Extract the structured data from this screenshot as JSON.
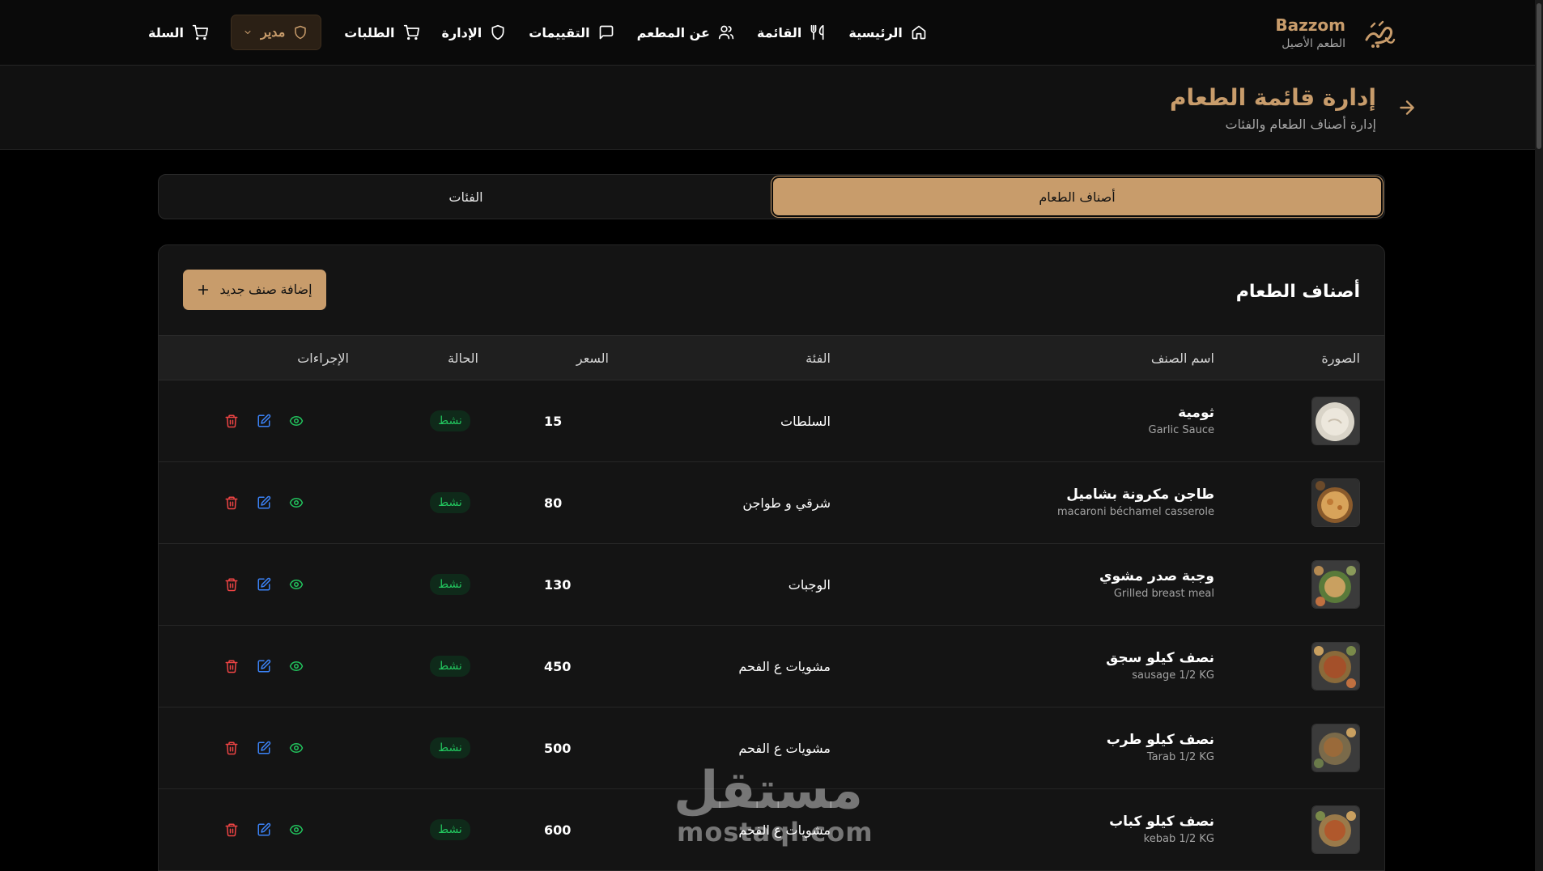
{
  "brand": {
    "name": "Bazzom",
    "tagline": "الطعم الأصيل",
    "logo_icon": "calligraphy-logo"
  },
  "nav": {
    "home": "الرئيسية",
    "menu": "القائمة",
    "about": "عن المطعم",
    "reviews": "التقييمات",
    "admin": "الإدارة",
    "orders": "الطلبات",
    "role": "مدير",
    "cart": "السلة"
  },
  "header": {
    "title": "إدارة قائمة الطعام",
    "subtitle": "إدارة أصناف الطعام والفئات"
  },
  "tabs": [
    {
      "label": "أصناف الطعام",
      "active": true
    },
    {
      "label": "الفئات",
      "active": false
    }
  ],
  "card": {
    "title": "أصناف الطعام",
    "add_button": "إضافة صنف جديد"
  },
  "table": {
    "columns": {
      "image": "الصورة",
      "name": "اسم الصنف",
      "category": "الفئة",
      "price": "السعر",
      "status": "الحالة",
      "actions": "الإجراءات"
    },
    "rows": [
      {
        "name_ar": "ثومية",
        "name_en": "Garlic Sauce",
        "category": "السلطات",
        "price": "15",
        "status": "نشط"
      },
      {
        "name_ar": "طاجن مكرونة بشاميل",
        "name_en": "macaroni béchamel casserole",
        "category": "شرقي و طواجن",
        "price": "80",
        "status": "نشط"
      },
      {
        "name_ar": "وجبة صدر مشوي",
        "name_en": "Grilled breast meal",
        "category": "الوجبات",
        "price": "130",
        "status": "نشط"
      },
      {
        "name_ar": "نصف كيلو سجق",
        "name_en": "sausage 1/2 KG",
        "category": "مشويات ع الفحم",
        "price": "450",
        "status": "نشط"
      },
      {
        "name_ar": "نصف كيلو طرب",
        "name_en": "Tarab 1/2 KG",
        "category": "مشويات ع الفحم",
        "price": "500",
        "status": "نشط"
      },
      {
        "name_ar": "نصف كيلو كباب",
        "name_en": "kebab 1/2 KG",
        "category": "مشويات ع الفحم",
        "price": "600",
        "status": "نشط"
      }
    ]
  },
  "watermark": {
    "arabic": "مستقل",
    "latin": "mostaql.com"
  },
  "colors": {
    "accent": "#c89c6b",
    "background": "#000000",
    "surface": "#141414",
    "status_active": "#22c55e",
    "delete": "#ef4444",
    "edit": "#3b82f6"
  }
}
